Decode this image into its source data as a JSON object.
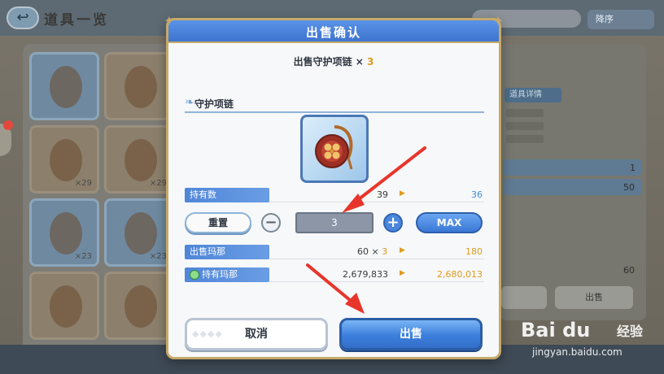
{
  "background": {
    "title": "道具一览",
    "sort_label": "降序",
    "detail_tab": "道具详情",
    "counts": [
      "×29",
      "×29",
      "×23",
      "×23"
    ],
    "right_values": [
      "1",
      "50",
      "60"
    ],
    "sell_button": "出售"
  },
  "dialog": {
    "title": "出售确认",
    "subtitle_prefix": "出售守护项链 ×",
    "subtitle_qty": "3",
    "item_name": "守护项链",
    "owned": {
      "label": "持有数",
      "old": "39",
      "new": "36"
    },
    "stepper": {
      "reset_label": "重置",
      "minus_symbol": "−",
      "value": "3",
      "plus_symbol": "+",
      "max_label": "MAX"
    },
    "sell_mana": {
      "label": "出售玛那",
      "unit_price": "60",
      "times": "×",
      "qty": "3",
      "total": "180"
    },
    "held_mana": {
      "label": "持有玛那",
      "old": "2,679,833",
      "new": "2,680,013"
    },
    "cancel_label": "取消",
    "confirm_label": "出售"
  },
  "colors": {
    "header_blue": "#3d74cf",
    "gold_border": "#c6a969",
    "accent_orange": "#e09a1c",
    "value_blue": "#3a8ee0",
    "annotation_red": "#e8352b"
  },
  "watermark": {
    "logo": "Bai du",
    "cn": "经验",
    "url": "jingyan.baidu.com"
  }
}
